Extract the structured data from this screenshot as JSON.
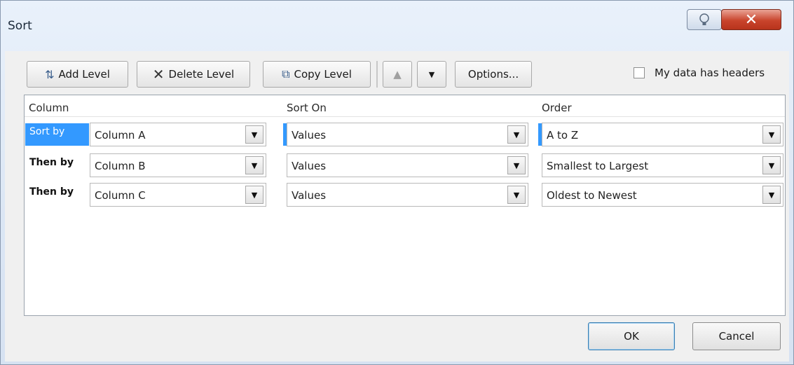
{
  "window": {
    "title": "Sort"
  },
  "toolbar": {
    "add_level": "Add Level",
    "delete_level": "Delete Level",
    "copy_level": "Copy Level",
    "move_up_icon": "arrow-up-icon",
    "move_down_icon": "arrow-down-icon",
    "options": "Options...",
    "headers_label": "My data has headers",
    "headers_checked": false
  },
  "grid": {
    "headers": {
      "column": "Column",
      "sort_on": "Sort On",
      "order": "Order"
    },
    "rows": [
      {
        "label": "Sort by",
        "column": "Column A",
        "sort_on": "Values",
        "order": "A to Z",
        "selected": true
      },
      {
        "label": "Then by",
        "column": "Column B",
        "sort_on": "Values",
        "order": "Smallest to Largest",
        "selected": false
      },
      {
        "label": "Then by",
        "column": "Column C",
        "sort_on": "Values",
        "order": "Oldest to Newest",
        "selected": false
      }
    ]
  },
  "buttons": {
    "ok": "OK",
    "cancel": "Cancel"
  },
  "colors": {
    "selection": "#3399ff",
    "close_button": "#c9442c"
  }
}
